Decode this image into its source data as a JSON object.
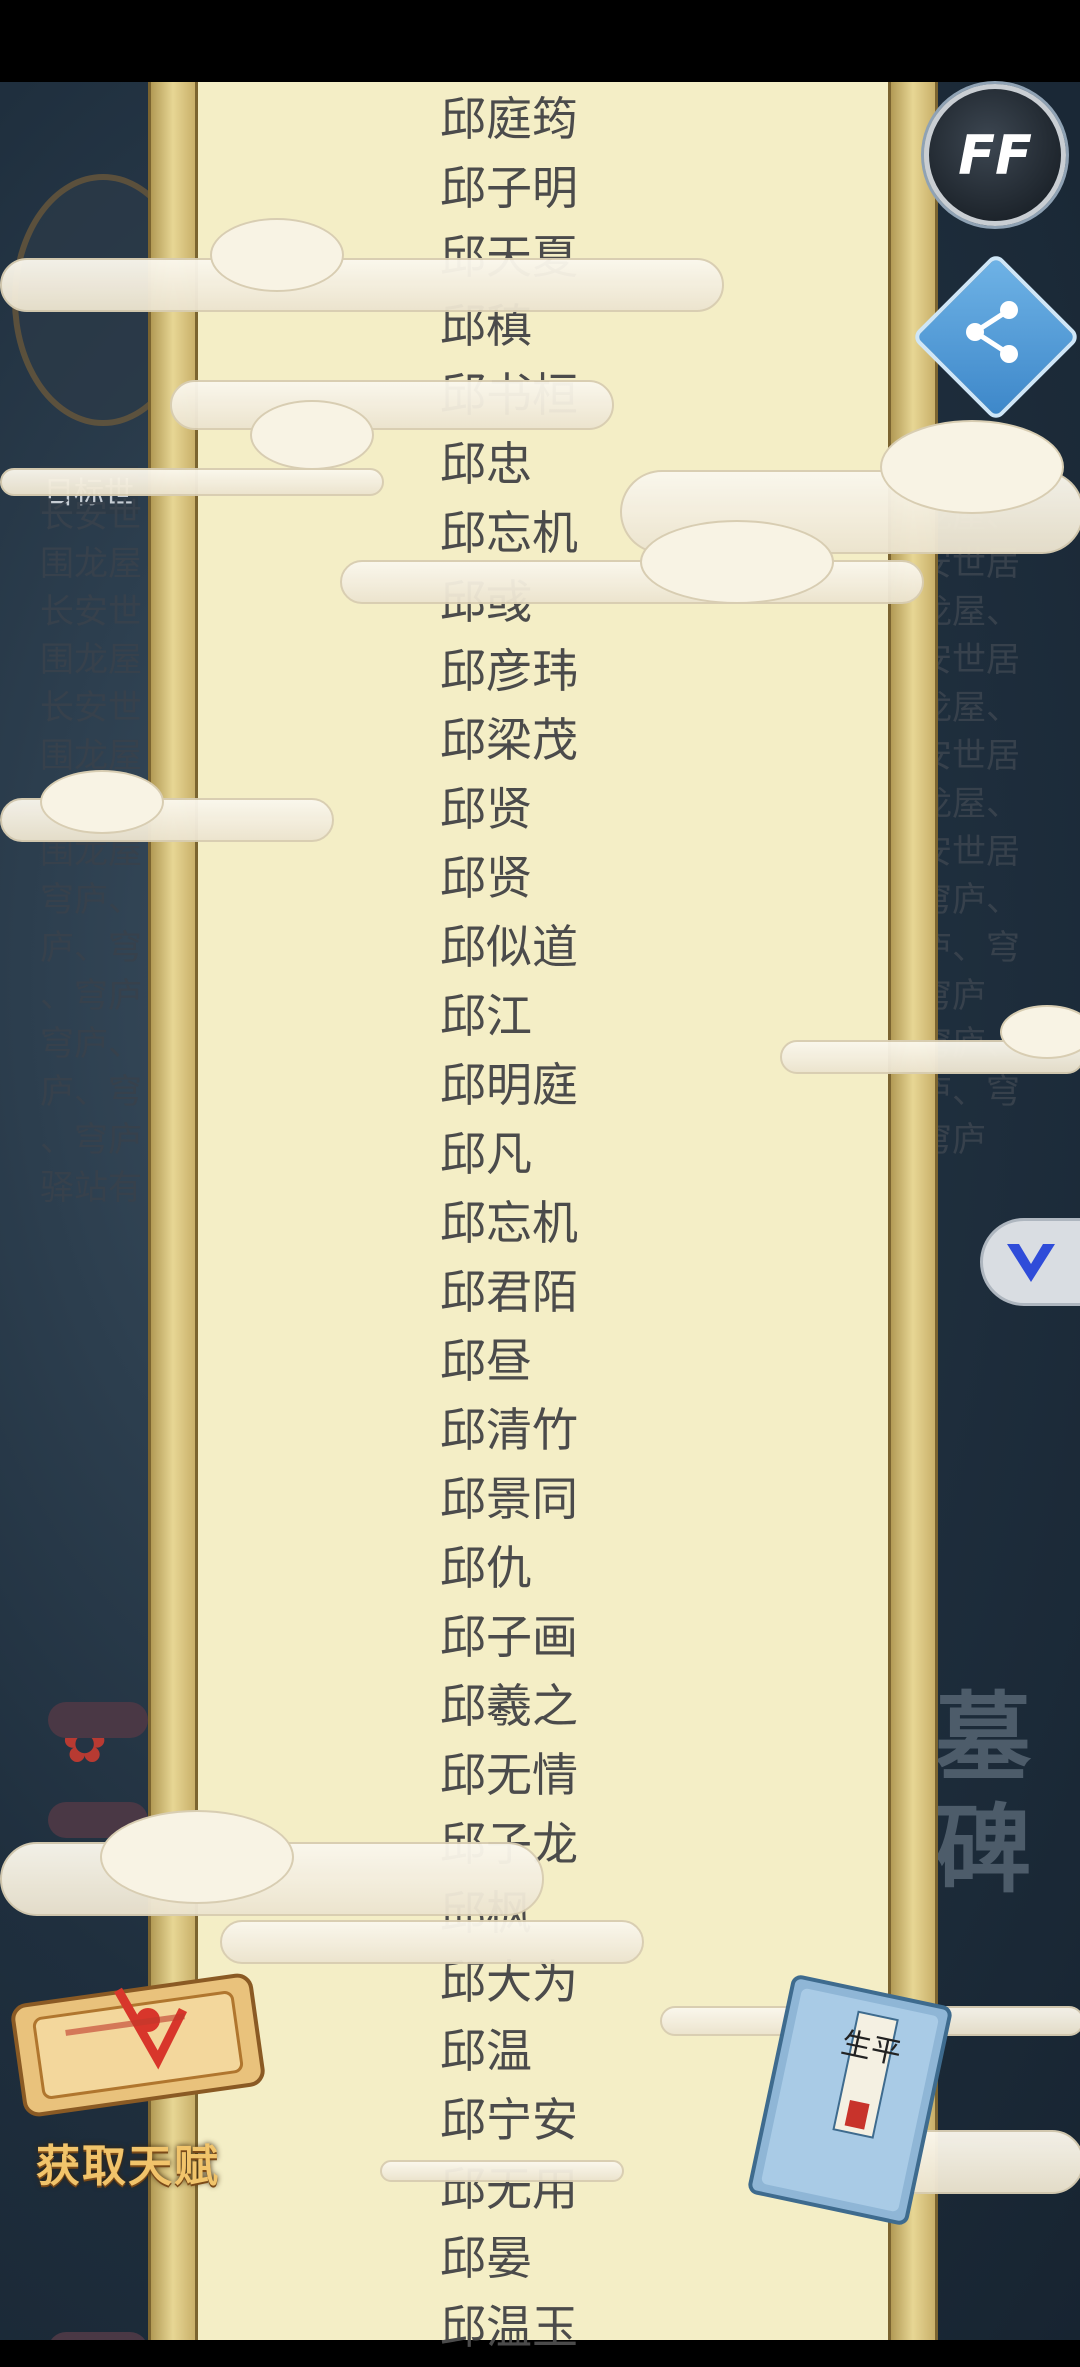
{
  "names": [
    "邱庭筠",
    "邱子明",
    "邱天夏",
    "邱稹",
    "邱书桓",
    "邱忠",
    "邱忘机",
    "邱彧",
    "邱彦玮",
    "邱梁茂",
    "邱贤",
    "邱贤",
    "邱似道",
    "邱江",
    "邱明庭",
    "邱凡",
    "邱忘机",
    "邱君陌",
    "邱昼",
    "邱清竹",
    "邱景同",
    "邱仇",
    "邱子画",
    "邱羲之",
    "邱无情",
    "邱子龙",
    "邱枫",
    "邱大为",
    "邱温",
    "邱宁安",
    "邱无用",
    "邱晏",
    "邱温玉"
  ],
  "background": {
    "tag_text": "目标世",
    "left_column": [
      "长安世",
      "围龙屋",
      "长安世",
      "围龙屋",
      "长安世",
      "围龙屋",
      "长安世",
      "围龙屋",
      "穹庐、",
      "庐、穹",
      "、穹庐",
      "穹庐、",
      "庐、穹",
      "、穹庐",
      "驿站有"
    ],
    "right_column": [
      "龙屋、",
      "安世居",
      "龙屋、",
      "安世居",
      "龙屋、",
      "安世居",
      "龙屋、",
      "安世居",
      "穹庐、",
      "庐、穹",
      "穹庐",
      "穹庐、",
      "庐、穹",
      "穹庐"
    ],
    "tomb_text": "墓碑"
  },
  "buttons": {
    "ff_label": "FF",
    "talent_label": "获取天赋",
    "book_label": "生平"
  },
  "colors": {
    "paper": "#f4eec6",
    "rod": "#c9b06a",
    "name_text": "#4b4b4b",
    "talent_gold": "#f1c46b"
  }
}
